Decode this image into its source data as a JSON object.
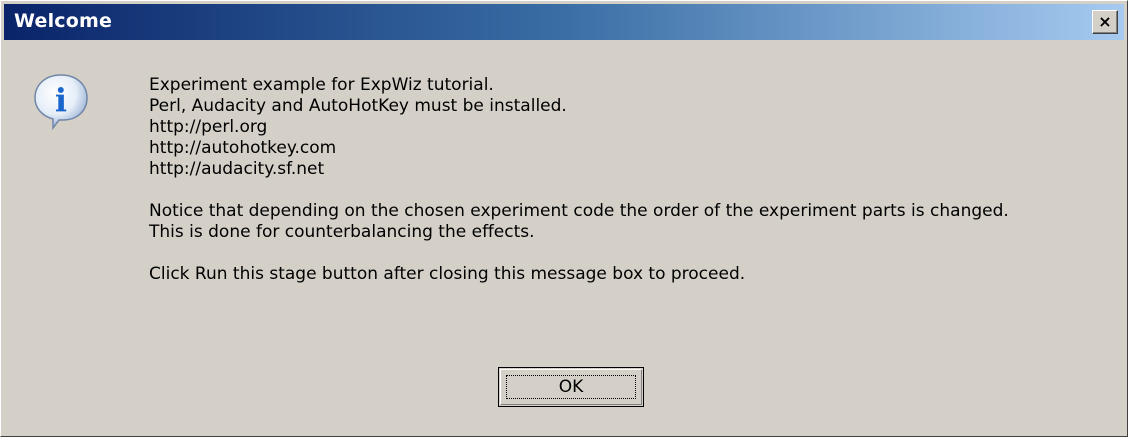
{
  "window": {
    "title": "Welcome",
    "close_label": "×",
    "title_gradient": [
      "#0a246a",
      "#a6caf0"
    ],
    "background": "#d4d0c8"
  },
  "icon": {
    "name": "info-icon",
    "glyph": "i",
    "color": "#1a66cc"
  },
  "message": {
    "lines": [
      "Experiment example for ExpWiz tutorial.",
      "Perl, Audacity and AutoHotKey must be installed.",
      "http://perl.org",
      "http://autohotkey.com",
      "http://audacity.sf.net",
      "",
      "Notice that depending on the chosen experiment code the order of the experiment parts is changed.",
      "This is done for counterbalancing the effects.",
      "",
      "Click Run this stage button after closing this message box to proceed."
    ]
  },
  "buttons": {
    "ok_label": "OK"
  }
}
